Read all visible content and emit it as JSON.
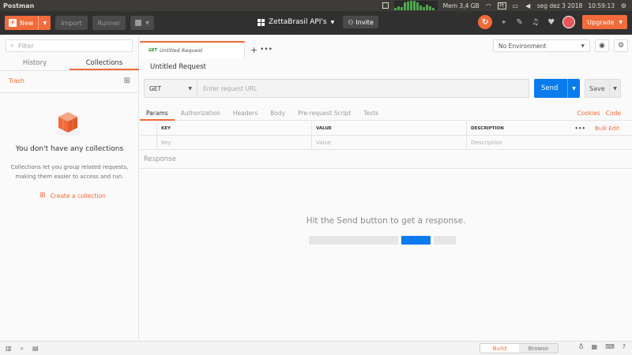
{
  "os": {
    "app_name": "Postman",
    "memory": "Mem 3,4 GB",
    "datetime": "seg dez  3 2018",
    "clock": "10:59:13",
    "pt_badge": "Pt"
  },
  "header": {
    "new_label": "New",
    "import_label": "Import",
    "runner_label": "Runner",
    "workspace_name": "ZettaBrasil API's",
    "invite_label": "Invite",
    "upgrade_label": "Upgrade"
  },
  "sidebar": {
    "filter_placeholder": "Filter",
    "tabs": [
      "History",
      "Collections"
    ],
    "active_tab": "Collections",
    "trash_label": "Trash",
    "empty_title": "You don't have any collections",
    "empty_desc": "Collections let you group related requests, making them easier to access and run.",
    "create_label": "Create a collection"
  },
  "request_tab": {
    "method": "GET",
    "title": "Untitled Request"
  },
  "environment": {
    "selected": "No Environment"
  },
  "request": {
    "title": "Untitled Request",
    "method": "GET",
    "url_placeholder": "Enter request URL",
    "send_label": "Send",
    "save_label": "Save"
  },
  "param_tabs": {
    "items": [
      "Params",
      "Authorization",
      "Headers",
      "Body",
      "Pre-request Script",
      "Tests"
    ],
    "active": "Params",
    "cookies": "Cookies",
    "code": "Code"
  },
  "params_table": {
    "headers": [
      "KEY",
      "VALUE",
      "DESCRIPTION"
    ],
    "placeholders": [
      "Key",
      "Value",
      "Description"
    ],
    "more": "•••",
    "bulk_edit": "Bulk Edit"
  },
  "response": {
    "label": "Response",
    "empty_text": "Hit the Send button to get a response."
  },
  "statusbar": {
    "build": "Build",
    "browse": "Browse"
  },
  "colors": {
    "accent": "#f26b3a",
    "send_blue": "#097bed",
    "header_bg": "#303030",
    "os_bar": "#3c3b37"
  }
}
